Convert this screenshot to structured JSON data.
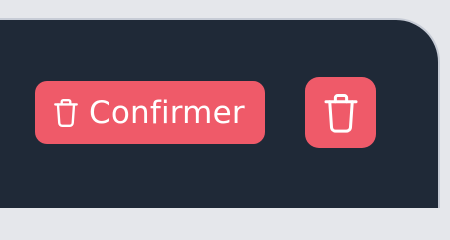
{
  "confirm_button": {
    "label": "Confirmer",
    "icon": "trash-icon"
  },
  "delete_button": {
    "icon": "trash-icon"
  },
  "colors": {
    "page_background": "#e5e7eb",
    "panel_background": "#1f2937",
    "danger_accent": "#ef5a69",
    "text_on_accent": "#ffffff"
  }
}
